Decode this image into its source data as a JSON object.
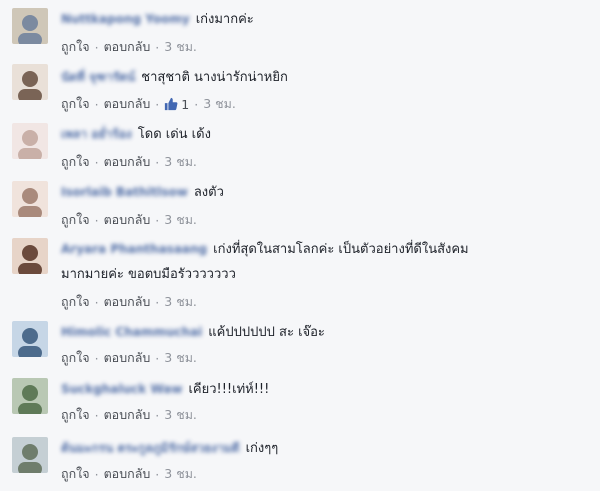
{
  "labels": {
    "like": "ถูกใจ",
    "reply": "ตอบกลับ",
    "sep": "·"
  },
  "colors": {
    "name": "#365899",
    "text": "#1d2129",
    "meta": "#90949c",
    "like_icon": "#4267b2",
    "background": "#f6f7f9"
  },
  "comments": [
    {
      "name": "Nuttkapong Yoomy",
      "text": "เก่งมากค่ะ",
      "time": "3 ชม.",
      "avatar_colors": [
        "#cfc7b8",
        "#7b8aa0"
      ]
    },
    {
      "name": "นัดที่ จุฑารัตน์",
      "text": "ชาสุชาติ นางน่ารักน่าหยิก",
      "time": "3 ชม.",
      "likes": "1",
      "avatar_colors": [
        "#e9e0d8",
        "#7a6456"
      ]
    },
    {
      "name": "เพลา อย่ำร้อง",
      "text": "โดด เด่น เด้ง",
      "time": "3 ชม.",
      "avatar_colors": [
        "#f1e6e4",
        "#c9b0a8"
      ]
    },
    {
      "name": "Isorlaib Bathitlsow",
      "text": "ลงตัว",
      "time": "3 ชม.",
      "avatar_colors": [
        "#f0e3dc",
        "#a98a7c"
      ]
    },
    {
      "name": "Aryara Phanthasaang",
      "text": "เก่งที่สุดในสามโลกค่ะ เป็นตัวอย่างที่ดีในสังคม",
      "text2": "มากมายค่ะ ขอตบมือรัววววววว",
      "time": "3 ชม.",
      "avatar_colors": [
        "#e7d4c8",
        "#6b4a3c"
      ]
    },
    {
      "name": "Himolic Chammuchai",
      "text": "แค้ปปปปปป สะ เจ๊อะ",
      "time": "3 ชม.",
      "avatar_colors": [
        "#c6d6e6",
        "#4d6b8c"
      ]
    },
    {
      "name": "Suckghaluck Waw",
      "text": "เคียว!!!เท่ห์!!!",
      "time": "3 ชม.",
      "avatar_colors": [
        "#b9c8b4",
        "#5f7a58"
      ]
    },
    {
      "name": "ต้นมะกรน ตระกูลภูมิรักษ์สวยงามดี",
      "text": "เก่งๆๆ",
      "time": "3 ชม.",
      "avatar_colors": [
        "#c5cfd4",
        "#6f7d6c"
      ]
    }
  ]
}
